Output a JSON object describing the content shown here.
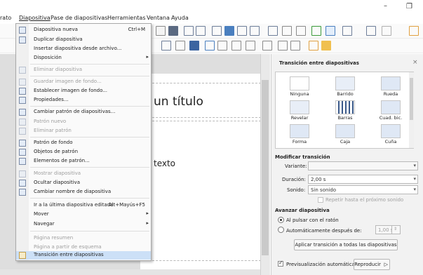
{
  "window": {
    "controls": {
      "minimize": "–",
      "restore": "❐"
    }
  },
  "menubar": {
    "items": [
      {
        "label": "rato"
      },
      {
        "label": "Diapositiva"
      },
      {
        "label": "Pase de diapositivas"
      },
      {
        "label": "Herramientas"
      },
      {
        "label": "Ventana"
      },
      {
        "label": "Ayuda"
      }
    ]
  },
  "slide": {
    "title_text": "un título",
    "body_text": "texto"
  },
  "menu": {
    "items": [
      {
        "label": "Diapositiva nueva",
        "shortcut": "Ctrl+M",
        "enabled": true,
        "icon": "new-slide-icon"
      },
      {
        "label": "Duplicar diapositiva",
        "enabled": true,
        "icon": "duplicate-slide-icon"
      },
      {
        "label": "Insertar diapositiva desde archivo...",
        "enabled": true
      },
      {
        "label": "Disposición",
        "enabled": true,
        "submenu": true
      },
      {
        "label": "Eliminar diapositiva",
        "enabled": false,
        "icon": "delete-slide-icon"
      },
      {
        "label": "Guardar imagen de fondo...",
        "enabled": false,
        "icon": "save-background-icon"
      },
      {
        "label": "Establecer imagen de fondo...",
        "enabled": true,
        "icon": "set-background-icon"
      },
      {
        "label": "Propiedades...",
        "enabled": true,
        "icon": "properties-icon"
      },
      {
        "label": "Cambiar patrón de diapositivas...",
        "enabled": true,
        "icon": "change-master-icon"
      },
      {
        "label": "Patrón nuevo",
        "enabled": false,
        "icon": "new-master-icon"
      },
      {
        "label": "Eliminar patrón",
        "enabled": false,
        "icon": "delete-master-icon"
      },
      {
        "label": "Patrón de fondo",
        "enabled": true,
        "icon": "master-background-icon"
      },
      {
        "label": "Objetos de patrón",
        "enabled": true,
        "icon": "master-objects-icon"
      },
      {
        "label": "Elementos de patrón...",
        "enabled": true,
        "icon": "master-elements-icon"
      },
      {
        "label": "Mostrar diapositiva",
        "enabled": false,
        "icon": "show-slide-icon"
      },
      {
        "label": "Ocultar diapositiva",
        "enabled": true,
        "icon": "hide-slide-icon"
      },
      {
        "label": "Cambiar nombre de diapositiva",
        "enabled": true,
        "icon": "rename-slide-icon"
      },
      {
        "label": "Ir a la última diapositiva editada",
        "shortcut": "Alt+Mayús+F5",
        "enabled": true
      },
      {
        "label": "Mover",
        "enabled": true,
        "submenu": true
      },
      {
        "label": "Navegar",
        "enabled": true,
        "submenu": true
      },
      {
        "label": "Página resumen",
        "enabled": false
      },
      {
        "label": "Página a partir de esquema",
        "enabled": false
      },
      {
        "label": "Transición entre diapositivas",
        "enabled": true,
        "highlighted": true,
        "icon": "slide-transition-icon"
      }
    ]
  },
  "sidebar": {
    "title": "Transición entre diapositivas",
    "close": "×",
    "gallery": [
      {
        "label": "Ninguna",
        "icon": "none-transition-icon"
      },
      {
        "label": "Barrido",
        "icon": "wipe-transition-icon"
      },
      {
        "label": "Rueda",
        "icon": "wheel-transition-icon"
      },
      {
        "label": "Revelar",
        "icon": "uncover-transition-icon"
      },
      {
        "label": "Barras",
        "icon": "bars-transition-icon"
      },
      {
        "label": "Cuad. bic.",
        "icon": "checkerboard-transition-icon"
      },
      {
        "label": "Forma",
        "icon": "shape-transition-icon"
      },
      {
        "label": "Caja",
        "icon": "box-transition-icon"
      },
      {
        "label": "Cuña",
        "icon": "wedge-transition-icon"
      }
    ],
    "modify": {
      "title": "Modificar transición",
      "variant_label": "Variante:",
      "variant_value": "",
      "duration_label": "Duración:",
      "duration_value": "2,00 s",
      "sound_label": "Sonido:",
      "sound_value": "Sin sonido",
      "repeat_label": "Repetir hasta el próximo sonido"
    },
    "advance": {
      "title": "Avanzar diapositiva",
      "on_click_label": "Al pulsar con el ratón",
      "auto_label": "Automáticamente después de:",
      "auto_value": "1,00 s"
    },
    "apply_all_label": "Aplicar transición a todas las diapositivas",
    "auto_preview_label": "Previsualización automática",
    "play_label": "Reproducir"
  },
  "colors": {
    "menu_highlight": "#cce0f7",
    "workspace": "#dedede",
    "sidebar": "#f2f2f2"
  }
}
